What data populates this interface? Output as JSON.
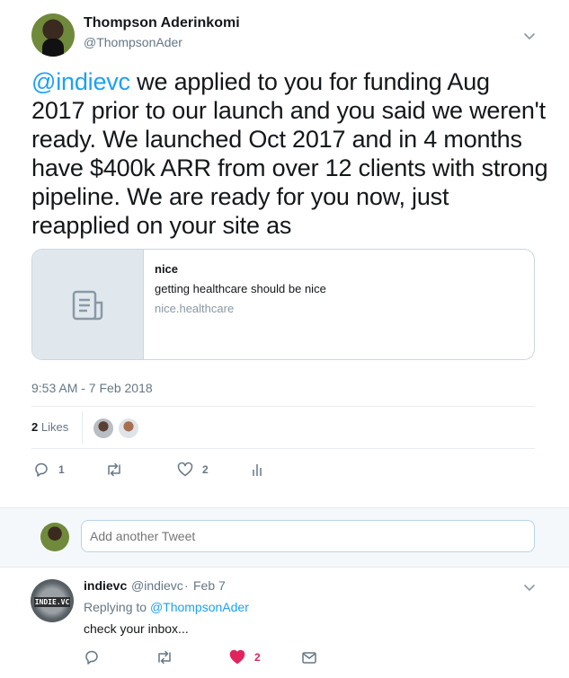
{
  "tweet": {
    "author_name": "Thompson Aderinkomi",
    "author_handle": "@ThompsonAder",
    "mention": "@indievc",
    "text_rest": " we applied to you for funding Aug 2017 prior to our launch and you said we weren't ready. We launched Oct 2017 and in 4 months have $400k ARR from over 12 clients with strong pipeline. We are ready for you now, just reapplied on your site as",
    "card": {
      "title": "nice",
      "description": "getting healthcare should be nice",
      "domain": "nice.healthcare",
      "icon": "document-icon"
    },
    "timestamp": "9:53 AM - 7 Feb 2018",
    "likes_count": "2",
    "likes_label": "Likes",
    "actions": {
      "reply_count": "1",
      "retweet_count": "",
      "like_count": "2"
    }
  },
  "reply_box": {
    "placeholder": "Add another Tweet"
  },
  "reply": {
    "author_name": "indievc",
    "author_handle": "@indievc",
    "separator": "·",
    "date": "Feb 7",
    "logo_text": "INDIE.VC",
    "replying_prefix": "Replying to ",
    "replying_to": "@ThompsonAder",
    "text": "check your inbox...",
    "actions": {
      "like_count": "2"
    }
  },
  "colors": {
    "link": "#1da1f2",
    "muted": "#657786",
    "like_active": "#e0245e",
    "border": "#e6ecf0"
  }
}
